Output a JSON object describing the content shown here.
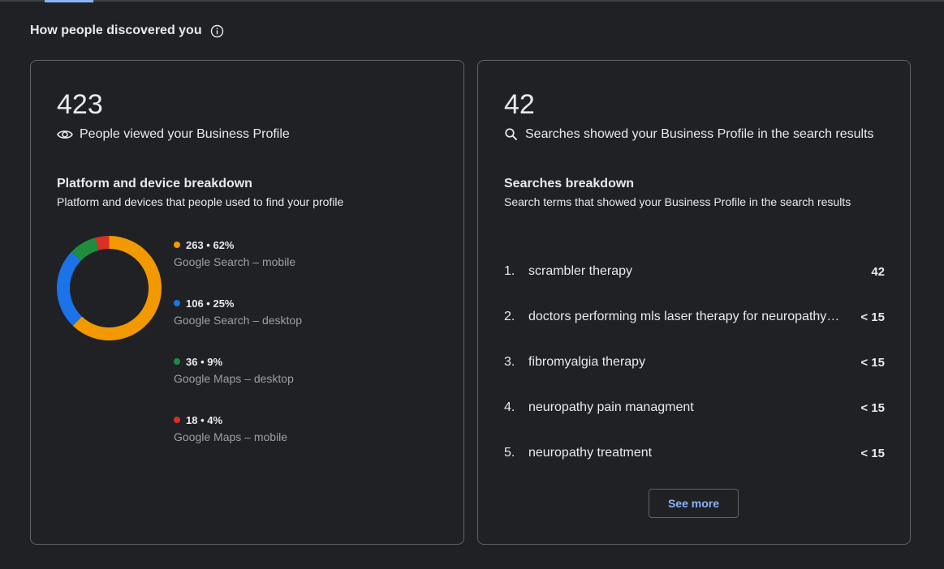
{
  "header": {
    "title": "How people discovered you",
    "info_icon": "info-icon"
  },
  "views_card": {
    "count": "423",
    "label": "People viewed your Business Profile",
    "icon": "eye-icon",
    "breakdown_title": "Platform and device breakdown",
    "breakdown_subtitle": "Platform and devices that people used to find your profile",
    "segments": [
      {
        "stat": "263 • 62%",
        "label": "Google Search – mobile",
        "value": 263,
        "percent": 62,
        "color": "#f29900"
      },
      {
        "stat": "106 • 25%",
        "label": "Google Search – desktop",
        "value": 106,
        "percent": 25,
        "color": "#1a73e8"
      },
      {
        "stat": "36 • 9%",
        "label": "Google Maps – desktop",
        "value": 36,
        "percent": 9,
        "color": "#1e8e3e"
      },
      {
        "stat": "18 • 4%",
        "label": "Google Maps – mobile",
        "value": 18,
        "percent": 4,
        "color": "#d93025"
      }
    ]
  },
  "searches_card": {
    "count": "42",
    "label": "Searches showed your Business Profile in the search results",
    "icon": "search-icon",
    "breakdown_title": "Searches breakdown",
    "breakdown_subtitle": "Search terms that showed your Business Profile in the search results",
    "terms": [
      {
        "rank": "1.",
        "term": "scrambler therapy",
        "count": "42"
      },
      {
        "rank": "2.",
        "term": "doctors performing mls laser therapy for neuropathy in my area",
        "count": "< 15"
      },
      {
        "rank": "3.",
        "term": "fibromyalgia therapy",
        "count": "< 15"
      },
      {
        "rank": "4.",
        "term": "neuropathy pain managment",
        "count": "< 15"
      },
      {
        "rank": "5.",
        "term": "neuropathy treatment",
        "count": "< 15"
      }
    ],
    "see_more_label": "See more"
  },
  "colors": {
    "background": "#202124",
    "border": "#5f6368",
    "accent": "#8ab4f8"
  }
}
